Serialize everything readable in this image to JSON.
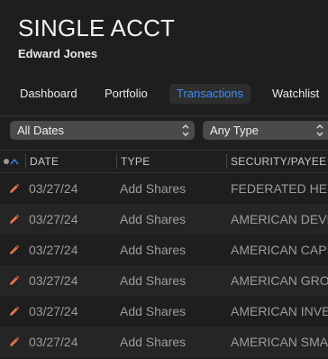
{
  "account": {
    "title": "SINGLE ACCT",
    "institution": "Edward Jones"
  },
  "tabs": [
    {
      "label": "Dashboard",
      "active": false
    },
    {
      "label": "Portfolio",
      "active": false
    },
    {
      "label": "Transactions",
      "active": true
    },
    {
      "label": "Watchlist",
      "active": false
    }
  ],
  "filters": {
    "date": "All Dates",
    "type": "Any Type"
  },
  "table": {
    "columns": [
      "DATE",
      "TYPE",
      "SECURITY/PAYEE"
    ],
    "rows": [
      {
        "date": "03/27/24",
        "type": "Add Shares",
        "security": "FEDERATED HERMES"
      },
      {
        "date": "03/27/24",
        "type": "Add Shares",
        "security": "AMERICAN DEVELOPING"
      },
      {
        "date": "03/27/24",
        "type": "Add Shares",
        "security": "AMERICAN CAPITAL"
      },
      {
        "date": "03/27/24",
        "type": "Add Shares",
        "security": "AMERICAN GROWTH"
      },
      {
        "date": "03/27/24",
        "type": "Add Shares",
        "security": "AMERICAN INVESTMENT"
      },
      {
        "date": "03/27/24",
        "type": "Add Shares",
        "security": "AMERICAN SMALLCAP"
      }
    ]
  },
  "colors": {
    "background": "#1e1e1e",
    "accent": "#3a8ef6",
    "edit_icon": "#e8734a"
  },
  "icons": {
    "edit": "pencil-icon",
    "select_chevron": "chevron-up-down-icon",
    "sort_ascending": "chevron-up-icon"
  }
}
